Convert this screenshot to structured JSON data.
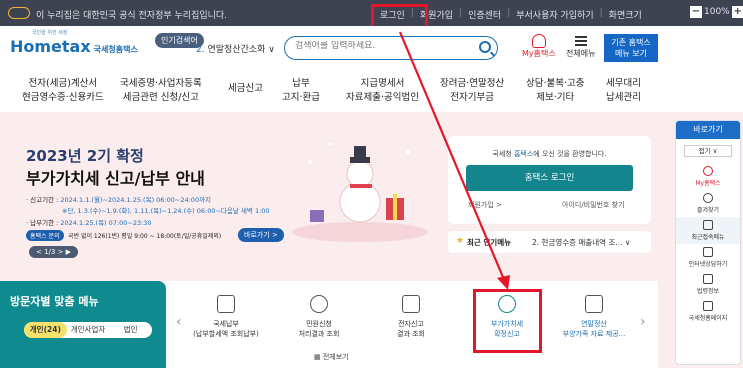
{
  "topbar": {
    "gov_notice": "이 누리집은 대한민국 공식 전자정부 누리집입니다.",
    "links": [
      "로그인",
      "회원가입",
      "인증센터",
      "부서사용자 가입하기",
      "화면크기"
    ],
    "font_size": "100%",
    "minus": "−",
    "plus": "+"
  },
  "header": {
    "logo_tagline": "국민을 위한 세정",
    "logo_text": "Hometax",
    "logo_sub": "국세청홈택스",
    "search_badge": "인기검색어",
    "search_rank": "2.",
    "search_term": "연말정산간소화",
    "search_placeholder": "검색어를 입력하세요.",
    "my_hometax": "My홈택스",
    "all_menu": "전체메뉴",
    "old_hometax_line1": "기존 홈택스",
    "old_hometax_line2": "메뉴 보기"
  },
  "nav": [
    "전자(세금)계산서\n현금영수증·신용카드",
    "국세증명·사업자등록\n세금관련 신청/신고",
    "세금신고",
    "납부\n고지·환급",
    "지급명세서\n자료제출·공익법인",
    "장려금·연말정산\n전자기부금",
    "상담·불복·고충\n제보·기타",
    "세무대리\n납세관리"
  ],
  "hero": {
    "title1": "2023년 2기 확정",
    "title2": "부가가치세 신고/납부 안내",
    "period_label": "· 신고기간 :",
    "period_value": "2024.1.1.(월)~2024.1.25.(목) 06:00~24:00까지",
    "period_note": "※단, 1.3.(수)~1.9.(화), 1.11.(목)~1.24.(수) 06:00~다음날 새벽 1:00",
    "pay_label": "· 납부기한 :",
    "pay_value": "2024.1.25.(목) 07:00~23:30",
    "inquiry_badge": "홈택스 문의",
    "inquiry_text": "국번 없이 126(1번) 평일 9:00 ~ 18:00(토/일/공휴일제외)",
    "go_button": "바로가기 >",
    "pager": "< 1/3 >  ▶"
  },
  "login": {
    "welcome_prefix": "국세청",
    "welcome_brand": "홈택스",
    "welcome_suffix": "에 오신 것을 환영합니다.",
    "login_button": "홈택스 로그인",
    "join": "회원가입 >",
    "find": "아이디/비밀번호 찾기"
  },
  "popular": {
    "title": "최근 인기메뉴",
    "item": "2.  현금영수증 매출내역 조... ∨"
  },
  "visit": {
    "title": "방문자별 맞춤 메뉴",
    "tabs": [
      "개인(24)",
      "개인사업자",
      "법인"
    ]
  },
  "services": [
    {
      "label": "국세납부\n(납부할세액 조회납부)"
    },
    {
      "label": "민원신청\n처리결과 조회"
    },
    {
      "label": "전자신고\n결과 조회"
    },
    {
      "label": "부가가치세\n확정신고"
    },
    {
      "label": "연말정산\n부양가족 자료 제공..."
    }
  ],
  "all_view": "전체보기",
  "side": {
    "head": "바로가기",
    "fold": "접기 ∨",
    "items": [
      "My홈택스",
      "즐겨찾기",
      "최근접속메뉴",
      "인터넷상담하기",
      "법령정보",
      "국세청홈페이지"
    ]
  },
  "colors": {
    "accent": "#1a6fb5",
    "highlight": "#e6162a",
    "teal": "#0f8b8f",
    "hero_bg": "#fbecee"
  }
}
